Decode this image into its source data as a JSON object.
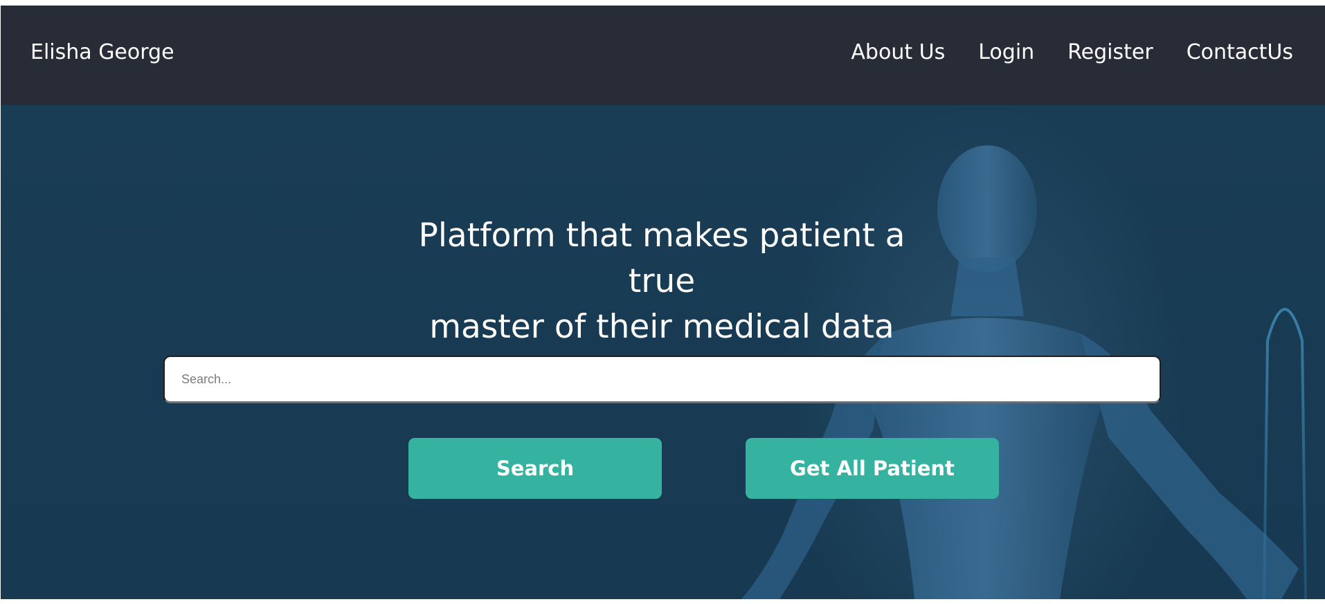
{
  "navbar": {
    "brand": "Elisha George",
    "links": [
      "About Us",
      "Login",
      "Register",
      "ContactUs"
    ]
  },
  "hero": {
    "headline_line1": "Platform that makes patient a true",
    "headline_line2": "master of their medical data",
    "search_placeholder": "Search...",
    "search_button": "Search",
    "get_all_button": "Get All Patient"
  },
  "colors": {
    "navbar_bg": "#282c36",
    "hero_bg": "#183b53",
    "button_bg": "#35b3a0",
    "text": "#ffffff"
  },
  "icons": {
    "hero_image": "human-body-figure"
  }
}
